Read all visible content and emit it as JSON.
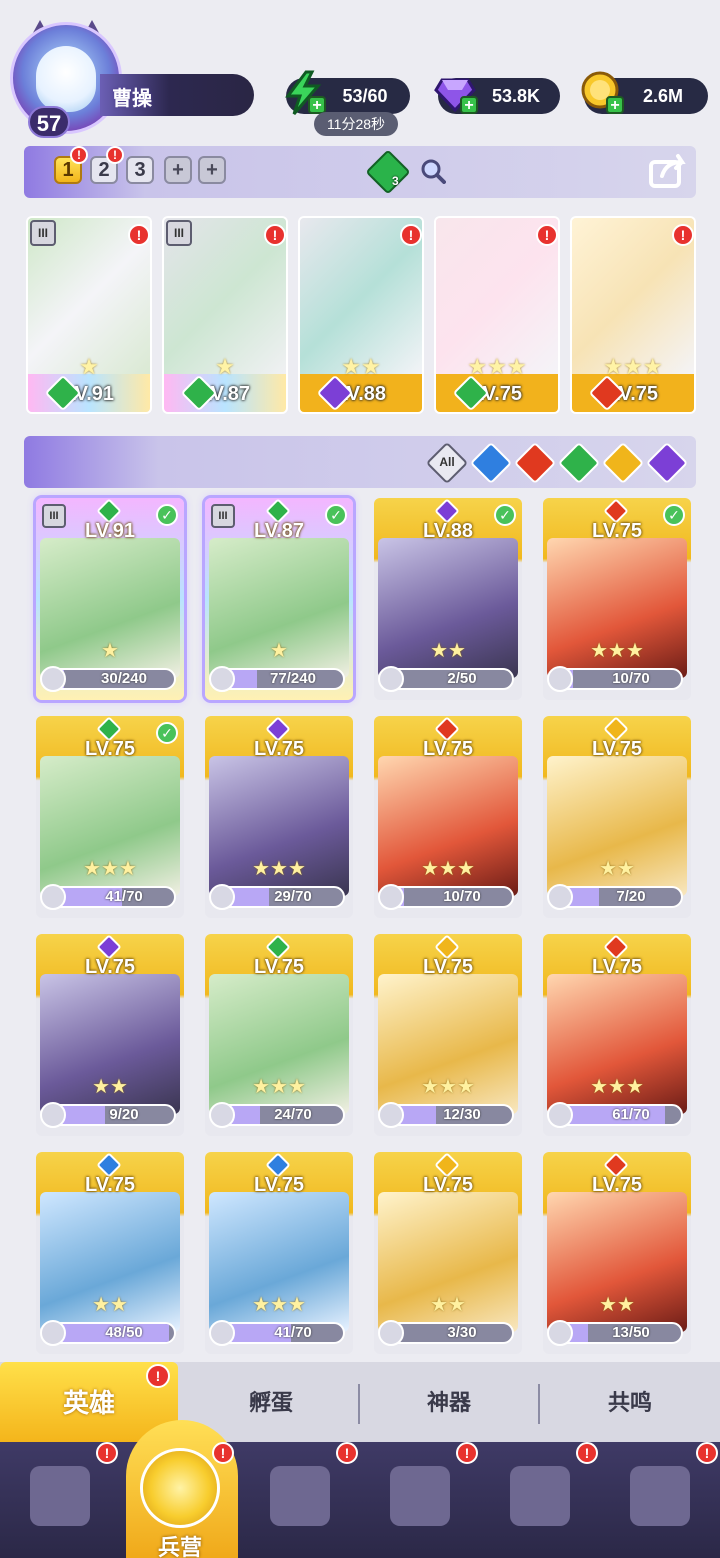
{
  "player": {
    "level": "57",
    "name": "曹操"
  },
  "resources": {
    "energy": {
      "value": "53/60",
      "timer": "11分28秒",
      "icon": "lightning-icon"
    },
    "diamonds": {
      "value": "53.8K",
      "icon": "diamond-icon"
    },
    "gold": {
      "value": "2.6M",
      "icon": "coin-icon"
    }
  },
  "team_tabs": [
    "1",
    "2",
    "3"
  ],
  "team_gem_count": "3",
  "lineup": [
    {
      "level": "LV.91",
      "stars": "★",
      "element": "nature",
      "rank": "III"
    },
    {
      "level": "LV.87",
      "stars": "★",
      "element": "nature",
      "rank": "III"
    },
    {
      "level": "LV.88",
      "stars": "★★",
      "element": "dark"
    },
    {
      "level": "LV.75",
      "stars": "★★★",
      "element": "nature"
    },
    {
      "level": "LV.75",
      "stars": "★★★",
      "element": "fire"
    }
  ],
  "filter": {
    "all_label": "All",
    "elements": [
      "water",
      "fire",
      "nature",
      "light",
      "dark"
    ]
  },
  "heroes": [
    {
      "level": "LV.91",
      "progress": "30/240",
      "frac": 0.125,
      "element": "nature",
      "check": true,
      "rank": "III",
      "stars": "★"
    },
    {
      "level": "LV.87",
      "progress": "77/240",
      "frac": 0.32,
      "element": "nature",
      "check": true,
      "rank": "III",
      "stars": "★"
    },
    {
      "level": "LV.88",
      "progress": "2/50",
      "frac": 0.04,
      "element": "dark",
      "check": true,
      "stars": "★★"
    },
    {
      "level": "LV.75",
      "progress": "10/70",
      "frac": 0.14,
      "element": "fire",
      "check": true,
      "stars": "★★★"
    },
    {
      "level": "LV.75",
      "progress": "41/70",
      "frac": 0.59,
      "element": "nature",
      "check": true,
      "stars": "★★★"
    },
    {
      "level": "LV.75",
      "progress": "29/70",
      "frac": 0.41,
      "element": "dark",
      "stars": "★★★"
    },
    {
      "level": "LV.75",
      "progress": "10/70",
      "frac": 0.14,
      "element": "fire",
      "stars": "★★★"
    },
    {
      "level": "LV.75",
      "progress": "7/20",
      "frac": 0.35,
      "element": "light",
      "stars": "★★"
    },
    {
      "level": "LV.75",
      "progress": "9/20",
      "frac": 0.45,
      "element": "dark",
      "stars": "★★"
    },
    {
      "level": "LV.75",
      "progress": "24/70",
      "frac": 0.34,
      "element": "nature",
      "stars": "★★★"
    },
    {
      "level": "LV.75",
      "progress": "12/30",
      "frac": 0.4,
      "element": "light",
      "stars": "★★★"
    },
    {
      "level": "LV.75",
      "progress": "61/70",
      "frac": 0.87,
      "element": "fire",
      "stars": "★★★"
    },
    {
      "level": "LV.75",
      "progress": "48/50",
      "frac": 0.96,
      "element": "water",
      "stars": "★★"
    },
    {
      "level": "LV.75",
      "progress": "41/70",
      "frac": 0.59,
      "element": "water",
      "stars": "★★★"
    },
    {
      "level": "LV.75",
      "progress": "3/30",
      "frac": 0.1,
      "element": "light",
      "stars": "★★"
    },
    {
      "level": "LV.75",
      "progress": "13/50",
      "frac": 0.26,
      "element": "fire",
      "stars": "★★"
    }
  ],
  "subtabs": [
    "英雄",
    "孵蛋",
    "神器",
    "共鸣"
  ],
  "nav": [
    {
      "icon": "cards-icon",
      "label": ""
    },
    {
      "icon": "barracks-icon",
      "label": "兵营"
    },
    {
      "icon": "map-icon",
      "label": ""
    },
    {
      "icon": "castle-icon",
      "label": ""
    },
    {
      "icon": "mushroom-icon",
      "label": ""
    },
    {
      "icon": "banner-icon",
      "label": ""
    }
  ],
  "colors": {
    "nature": "#2fb24a",
    "dark": "#7c3fd6",
    "fire": "#e0391f",
    "water": "#2f7fe0",
    "light": "#f0b51b",
    "gold": "#f1b81e",
    "accent": "#8f7ae2"
  }
}
